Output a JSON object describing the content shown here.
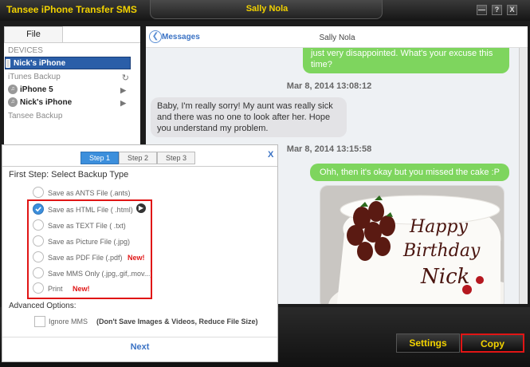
{
  "app": {
    "title": "Tansee iPhone Transfer SMS",
    "contact_name": "Sally Nola",
    "window_buttons": {
      "minimize": "—",
      "help": "?",
      "close": "X"
    }
  },
  "left_panel": {
    "tab": "File",
    "sections": {
      "devices": "DEVICES",
      "itunes": "iTunes Backup",
      "tansee": "Tansee Backup"
    },
    "devices": [
      {
        "label": "Nick's iPhone",
        "selected": true
      }
    ],
    "itunes_items": [
      {
        "label": "iPhone 5"
      },
      {
        "label": "Nick's iPhone"
      }
    ]
  },
  "chat": {
    "back_label": "Messages",
    "header_name": "Sally Nola",
    "messages": [
      {
        "side": "right",
        "text": "just very disappointed. What's your excuse this time?"
      },
      {
        "type": "timestamp",
        "text": "Mar 8, 2014 13:08:12"
      },
      {
        "side": "left",
        "text": "Baby, I'm really sorry! My aunt was really sick and there was no one to look after her. Hope you understand my problem."
      },
      {
        "type": "timestamp",
        "text": "Mar 8, 2014 13:15:58"
      },
      {
        "side": "right",
        "text": "Ohh, then it's okay but you missed the cake :P"
      }
    ],
    "image_text": [
      "Happy",
      "Birthday",
      "Nick"
    ]
  },
  "bottom": {
    "settings": "Settings",
    "copy": "Copy"
  },
  "dialog": {
    "steps": [
      "Step 1",
      "Step 2",
      "Step 3"
    ],
    "close": "X",
    "heading": "First Step: Select Backup Type",
    "options": [
      {
        "label": "Save as ANTS File (.ants)",
        "checked": false
      },
      {
        "label": "Save as HTML File ( .html)",
        "checked": true
      },
      {
        "label": "Save as TEXT File ( .txt)",
        "checked": false
      },
      {
        "label": "Save as Picture File (.jpg)",
        "checked": false
      },
      {
        "label": "Save as PDF File (.pdf)",
        "checked": false,
        "new": "New!"
      },
      {
        "label": "Save MMS Only (.jpg,.gif,.mov...)",
        "checked": false
      },
      {
        "label": "Print",
        "checked": false,
        "new": "New!"
      }
    ],
    "advanced": "Advanced Options:",
    "ignore_label": "Ignore MMS",
    "ignore_desc": "(Don't Save Images & Videos, Reduce File Size)",
    "next": "Next"
  },
  "colors": {
    "accent": "#f2d200",
    "selection": "#2a5ea8",
    "bubble_out": "#7ed55e",
    "highlight": "#e01515"
  }
}
